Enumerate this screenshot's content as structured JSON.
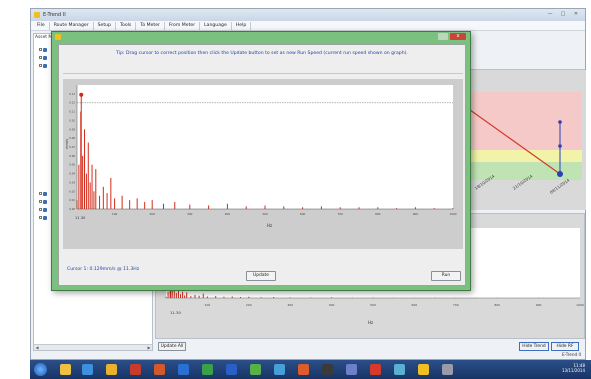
{
  "app": {
    "title": "E-Trend II",
    "menu": [
      "File",
      "Route Manager",
      "Setup",
      "Tools",
      "To Meter",
      "From Meter",
      "Language",
      "Help"
    ],
    "left_panel_title": "Asset M",
    "update_all_label": "Update All",
    "hide_trend_label": "Hide Trend",
    "hide_rf_label": "Hide RF",
    "status_text": "E-Trend II"
  },
  "dialog": {
    "tip": "Tip: Drag cursor to correct position then click the Update button to set as new Run Speed (current run speed shown on graph).",
    "cursor_text": "Cursor 1: 0.129mm/s @ 11.3Hz",
    "update_label": "Update",
    "run_label": "Run",
    "close_label": "x",
    "icons": [
      "app-icon",
      "close-icon"
    ]
  },
  "chart_data": {
    "type": "line",
    "xlabel": "Hz",
    "ylabel": "mm/s",
    "x_start_label": "11.30",
    "xlim": [
      0,
      1000
    ],
    "ylim": [
      0,
      0.14
    ],
    "xticks": [
      0,
      100,
      200,
      300,
      400,
      500,
      600,
      700,
      800,
      900,
      1000
    ],
    "yticks": [
      0,
      0.01,
      0.02,
      0.03,
      0.04,
      0.05,
      0.06,
      0.07,
      0.08,
      0.09,
      0.1,
      0.11,
      0.12,
      0.13
    ],
    "threshold_y": 0.12,
    "cursor_x": 11.3,
    "cursor_y": 0.129,
    "series": [
      {
        "x": [
          0,
          5,
          10,
          11.3,
          15,
          20,
          25,
          30,
          35,
          40,
          45,
          50,
          60,
          70,
          80,
          90,
          100,
          120,
          140,
          160,
          180,
          200,
          230,
          260,
          300,
          350,
          400,
          450,
          500,
          550,
          600,
          650,
          700,
          750,
          800,
          850,
          900,
          950,
          1000
        ],
        "y": [
          0.01,
          0.05,
          0.11,
          0.129,
          0.06,
          0.09,
          0.04,
          0.075,
          0.03,
          0.05,
          0.02,
          0.045,
          0.015,
          0.025,
          0.018,
          0.035,
          0.012,
          0.015,
          0.01,
          0.012,
          0.008,
          0.01,
          0.006,
          0.008,
          0.005,
          0.004,
          0.006,
          0.003,
          0.004,
          0.003,
          0.002,
          0.003,
          0.002,
          0.002,
          0.002,
          0.001,
          0.002,
          0.001,
          0.001
        ]
      }
    ],
    "colors": {
      "series": "#d42a1a",
      "threshold": "#9a9a9a",
      "cursor": "#d42a1a"
    }
  },
  "background_chart": {
    "labels": [
      "18/10/2014",
      "21/10/2014",
      "04/11/2014"
    ],
    "zone_colors": {
      "alarm": "#f6c9c9",
      "warning": "#f2f2a8",
      "ok": "#bfe3b3"
    },
    "trend_color": "#d23a2a",
    "marker_color": "#2a3fb5",
    "spectrum_xlabel": "Hz",
    "spectrum_x_start_label": "11.30",
    "spectrum_xticks": [
      0,
      100,
      200,
      300,
      400,
      500,
      600,
      700,
      800,
      900,
      1000
    ]
  },
  "taskbar": {
    "time": "11:48",
    "date": "13/11/2014"
  }
}
